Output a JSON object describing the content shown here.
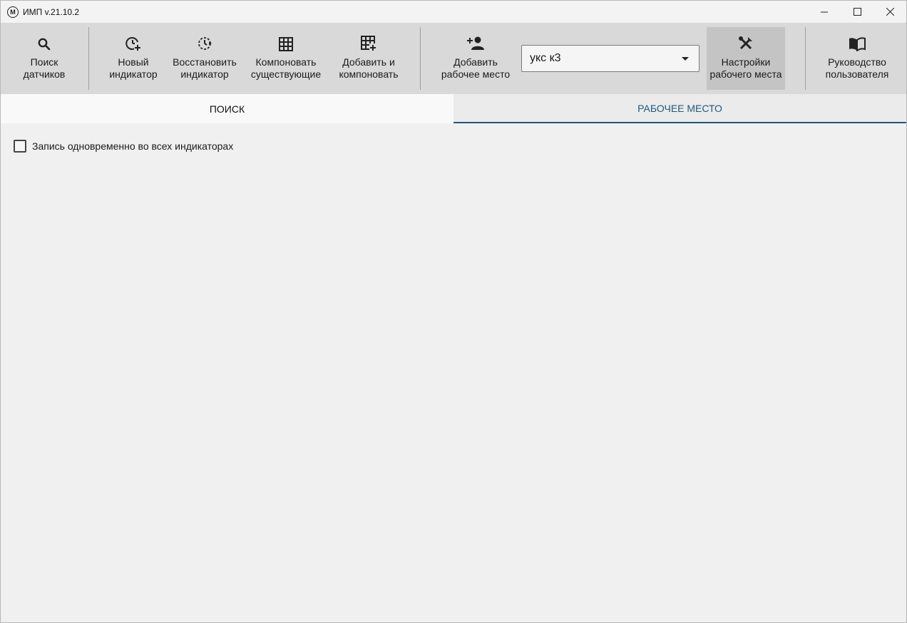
{
  "window": {
    "logo_letter": "М",
    "title": "ИМП  v.21.10.2"
  },
  "toolbar": {
    "search_sensors": {
      "line1": "Поиск",
      "line2": "датчиков",
      "icon": "search-icon"
    },
    "new_indicator": {
      "line1": "Новый",
      "line2": "индикатор",
      "icon": "clock-plus-icon"
    },
    "restore_indicator": {
      "line1": "Восстановить",
      "line2": "индикатор",
      "icon": "restore-clock-icon"
    },
    "compose_existing": {
      "line1": "Компоновать",
      "line2": "существующие",
      "icon": "grid-icon"
    },
    "add_and_compose": {
      "line1": "Добавить и",
      "line2": "компоновать",
      "icon": "grid-plus-icon"
    },
    "add_workplace": {
      "line1": "Добавить",
      "line2": "рабочее место",
      "icon": "add-user-icon"
    },
    "workplace_select": {
      "value": "укс к3"
    },
    "workplace_settings": {
      "line1": "Настройки",
      "line2": "рабочего места",
      "icon": "tools-icon"
    },
    "user_guide": {
      "line1": "Руководство",
      "line2": "пользователя",
      "icon": "book-icon"
    }
  },
  "tabs": [
    {
      "label": "ПОИСК",
      "active": false
    },
    {
      "label": "РАБОЧЕЕ МЕСТО",
      "active": true
    }
  ],
  "workplace": {
    "record_all_label": "Запись одновременно во всех индикаторах",
    "record_all_checked": false
  },
  "colors": {
    "accent": "#1c5a80",
    "toolbar_bg": "#d9d9d9",
    "content_bg": "#f0f0f0"
  }
}
